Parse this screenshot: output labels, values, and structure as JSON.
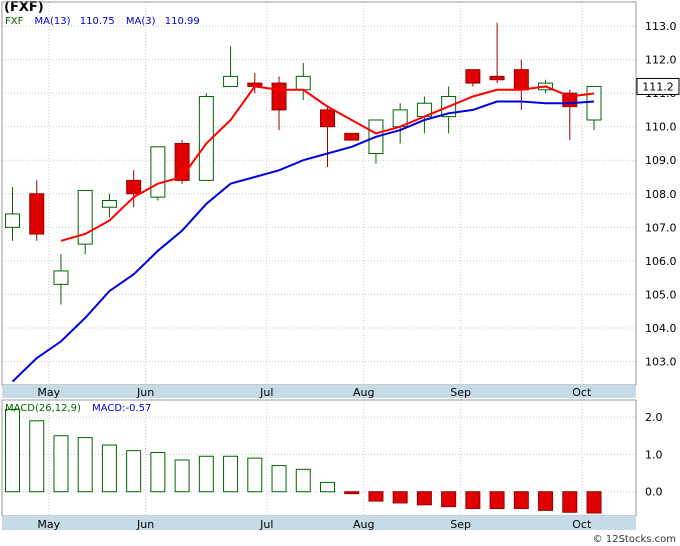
{
  "title": "(FXF)",
  "footer": "© 12Stocks.com",
  "colors": {
    "up": "#ffffff",
    "up_border": "#006400",
    "down": "#e00000",
    "ma13": "#0000dd",
    "ma3": "#ff0000",
    "macd": "#006400",
    "grid": "#c8c8c8",
    "axis_band": "#c5dce8",
    "label_fx": "#006400",
    "label_ma": "#0000cc"
  },
  "legend": {
    "ticker": "FXF",
    "ma13_label": "MA(13)",
    "ma13_value": "110.75",
    "ma3_label": "MA(3)",
    "ma3_value": "110.99"
  },
  "macd_legend": {
    "label": "MACD(26,12,9)",
    "value_label": "MACD:-0.57"
  },
  "chart_data": [
    {
      "type": "candlestick",
      "title": "(FXF)",
      "x_labels": [
        "May",
        "Jun",
        "Jul",
        "Aug",
        "Sep",
        "Oct"
      ],
      "x_label_index": [
        1,
        5,
        10,
        14,
        18,
        23
      ],
      "ylim": [
        102.3,
        113.3
      ],
      "y_ticks": [
        "103.0",
        "104.0",
        "105.0",
        "106.0",
        "107.0",
        "108.0",
        "109.0",
        "110.0",
        "111.0",
        "112.0",
        "113.0"
      ],
      "last_price": "111.2",
      "grid": true,
      "candles": [
        {
          "o": 107.0,
          "h": 108.2,
          "l": 106.6,
          "c": 107.4
        },
        {
          "o": 108.0,
          "h": 108.4,
          "l": 106.6,
          "c": 106.8
        },
        {
          "o": 105.3,
          "h": 106.2,
          "l": 104.7,
          "c": 105.7
        },
        {
          "o": 106.5,
          "h": 108.1,
          "l": 106.2,
          "c": 108.1
        },
        {
          "o": 107.6,
          "h": 108.0,
          "l": 107.3,
          "c": 107.8
        },
        {
          "o": 108.4,
          "h": 108.7,
          "l": 107.6,
          "c": 108.0
        },
        {
          "o": 107.9,
          "h": 109.4,
          "l": 107.8,
          "c": 109.4
        },
        {
          "o": 109.5,
          "h": 109.6,
          "l": 108.3,
          "c": 108.4
        },
        {
          "o": 108.4,
          "h": 111.0,
          "l": 108.4,
          "c": 110.9
        },
        {
          "o": 111.2,
          "h": 112.4,
          "l": 111.2,
          "c": 111.5
        },
        {
          "o": 111.3,
          "h": 111.6,
          "l": 111.0,
          "c": 111.2
        },
        {
          "o": 111.3,
          "h": 111.5,
          "l": 109.9,
          "c": 110.5
        },
        {
          "o": 111.1,
          "h": 111.9,
          "l": 110.8,
          "c": 111.5
        },
        {
          "o": 110.5,
          "h": 110.6,
          "l": 108.8,
          "c": 110.0
        },
        {
          "o": 109.8,
          "h": 109.8,
          "l": 109.6,
          "c": 109.6
        },
        {
          "o": 109.2,
          "h": 110.2,
          "l": 108.9,
          "c": 110.2
        },
        {
          "o": 110.0,
          "h": 110.7,
          "l": 109.5,
          "c": 110.5
        },
        {
          "o": 110.3,
          "h": 110.9,
          "l": 109.8,
          "c": 110.7
        },
        {
          "o": 110.3,
          "h": 111.2,
          "l": 109.8,
          "c": 110.9
        },
        {
          "o": 111.7,
          "h": 111.7,
          "l": 111.2,
          "c": 111.3
        },
        {
          "o": 111.5,
          "h": 113.1,
          "l": 111.3,
          "c": 111.4
        },
        {
          "o": 111.7,
          "h": 112.0,
          "l": 110.5,
          "c": 111.1
        },
        {
          "o": 111.1,
          "h": 111.4,
          "l": 111.0,
          "c": 111.3
        },
        {
          "o": 111.0,
          "h": 111.1,
          "l": 109.6,
          "c": 110.6
        },
        {
          "o": 110.2,
          "h": 111.2,
          "l": 109.9,
          "c": 111.2
        }
      ],
      "series": [
        {
          "name": "MA(13)",
          "values": [
            102.4,
            103.1,
            103.6,
            104.3,
            105.1,
            105.6,
            106.3,
            106.9,
            107.7,
            108.3,
            108.5,
            108.7,
            109.0,
            109.2,
            109.4,
            109.7,
            109.9,
            110.2,
            110.4,
            110.5,
            110.75,
            110.75,
            110.7,
            110.7,
            110.75
          ]
        },
        {
          "name": "MA(3)",
          "values": [
            null,
            null,
            106.6,
            106.8,
            107.2,
            107.9,
            108.3,
            108.5,
            109.5,
            110.2,
            111.2,
            111.1,
            111.1,
            110.6,
            110.2,
            109.8,
            110.0,
            110.3,
            110.6,
            110.9,
            111.1,
            111.1,
            111.2,
            110.9,
            110.99
          ]
        }
      ]
    },
    {
      "type": "bar",
      "title": "MACD(26,12,9)",
      "categories": [
        "May",
        "Jun",
        "Jul",
        "Aug",
        "Sep",
        "Oct"
      ],
      "ylim": [
        -0.65,
        2.35
      ],
      "y_ticks": [
        "0.0",
        "1.0",
        "2.0"
      ],
      "grid": true,
      "values": [
        2.2,
        1.9,
        1.5,
        1.45,
        1.25,
        1.1,
        1.05,
        0.85,
        0.95,
        0.95,
        0.9,
        0.7,
        0.6,
        0.25,
        -0.05,
        -0.25,
        -0.3,
        -0.35,
        -0.4,
        -0.45,
        -0.45,
        -0.45,
        -0.5,
        -0.55,
        -0.57
      ]
    }
  ]
}
